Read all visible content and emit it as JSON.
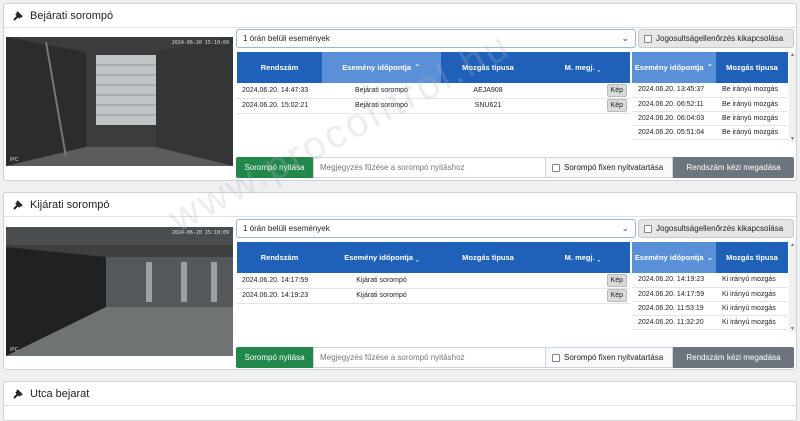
{
  "panels": [
    {
      "title": "Bejárati sorompó",
      "camera": {
        "timestamp": "2024-06-20 15:10:09",
        "logo": "IPC"
      },
      "select_value": "1 órán belüli események",
      "check_label": "Jogosultságellenőrzés kikapcsolása",
      "table_headers": [
        "Rendszám",
        "Esemény időpontja",
        "Mozgás típusa",
        "M. megj."
      ],
      "rows": [
        {
          "time": "2024.06.20. 14:47:33",
          "event": "Bejárati sorompó",
          "plate": "AEJA908",
          "action": "Kép"
        },
        {
          "time": "2024.06.20. 15:02:21",
          "event": "Bejárati sorompó",
          "plate": "SNU621",
          "action": "Kép"
        }
      ],
      "right_headers": [
        "Esemény időpontja",
        "Mozgás típusa"
      ],
      "right_rows": [
        {
          "time": "2024.06.20. 13:45:37",
          "type": "Be irányú mozgás"
        },
        {
          "time": "2024.06.20. 06:52:11",
          "type": "Be irányú mozgás"
        },
        {
          "time": "2024.06.20. 06:04:03",
          "type": "Be irányú mozgás"
        },
        {
          "time": "2024.06.20. 05:51:04",
          "type": "Be irányú mozgás"
        }
      ],
      "open_btn": "Sorompó nyitása",
      "note_placeholder": "Megjegyzés fűzése a sorompó nyitáshoz",
      "keep_open": "Sorompó fixen nyitvatartása",
      "manual_btn": "Rendszám kézi megadása"
    },
    {
      "title": "Kijárati sorompó",
      "camera": {
        "timestamp": "2024-06-20 15:10:09",
        "logo": "IPC"
      },
      "select_value": "1 órán belüli események",
      "check_label": "Jogosultságellenőrzés kikapcsolása",
      "table_headers": [
        "Rendszám",
        "Esemény időpontja",
        "Mozgás típusa",
        "M. megj."
      ],
      "rows": [
        {
          "time": "2024.06.20. 14:17:59",
          "event": "Kijárati sorompó",
          "plate": "",
          "action": "Kép"
        },
        {
          "time": "2024.06.20. 14:19:23",
          "event": "Kijárati sorompó",
          "plate": "",
          "action": "Kép"
        }
      ],
      "right_headers": [
        "Esemény időpontja",
        "Mozgás típusa"
      ],
      "right_rows": [
        {
          "time": "2024.06.20. 14:19:23",
          "type": "Ki irányú mozgás"
        },
        {
          "time": "2024.06.20. 14:17:59",
          "type": "Ki irányú mozgás"
        },
        {
          "time": "2024.06.20. 11:53:19",
          "type": "Ki irányú mozgás"
        },
        {
          "time": "2024.06.20. 11:32:20",
          "type": "Ki irányú mozgás"
        }
      ],
      "open_btn": "Sorompó nyitása",
      "note_placeholder": "Megjegyzés fűzése a sorompó nyitáshoz",
      "keep_open": "Sorompó fixen nyitvatartása",
      "manual_btn": "Rendszám kézi megadása"
    },
    {
      "title": "Utca bejarat"
    }
  ],
  "watermark": "www.procontrol.hu",
  "colors": {
    "header_blue": "#1f61b8",
    "sorted_blue": "#5a90d8",
    "green": "#21874a",
    "gray": "#6c757d"
  }
}
